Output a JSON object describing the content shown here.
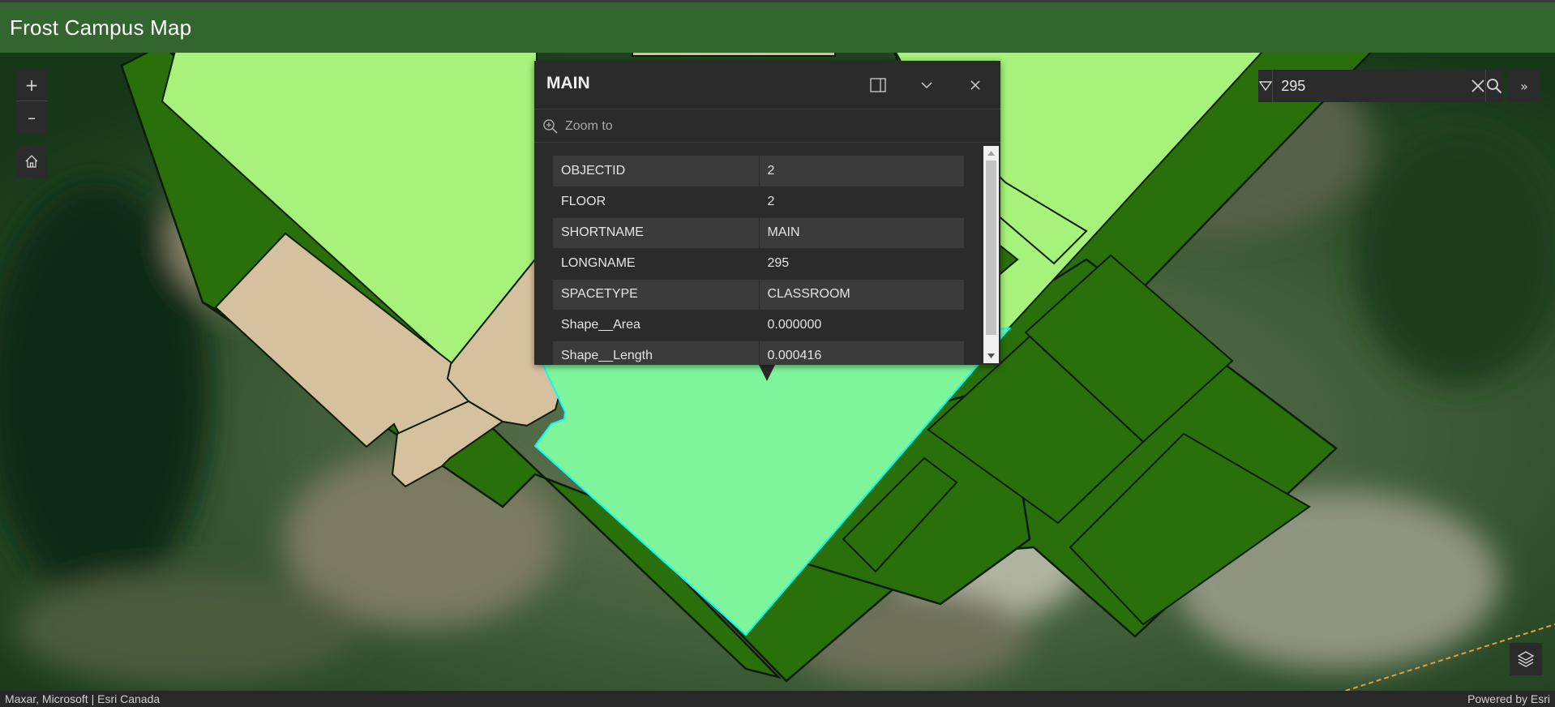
{
  "header": {
    "title": "Frost Campus Map"
  },
  "map": {
    "zoom_in_label": "+",
    "zoom_out_label": "–",
    "home_icon": "home-icon",
    "layers_icon": "layers-icon",
    "search": {
      "value": "295",
      "source_icon": "caret-down-icon",
      "clear_icon": "close-icon",
      "submit_icon": "search-icon",
      "expand_label": "»"
    },
    "highlight_color": "#00ffff",
    "feature_colors": {
      "selected": "#7ef59a",
      "open_space": "#a6f27a",
      "wall": "#2a700a",
      "room_beige": "#d6c19e"
    }
  },
  "popup": {
    "title": "MAIN",
    "dock_icon": "dock-icon",
    "collapse_icon": "chevron-down-icon",
    "close_icon": "close-icon",
    "zoom_to_label": "Zoom to",
    "fields": [
      {
        "name": "OBJECTID",
        "value": "2"
      },
      {
        "name": "FLOOR",
        "value": "2"
      },
      {
        "name": "SHORTNAME",
        "value": "MAIN"
      },
      {
        "name": "LONGNAME",
        "value": "295"
      },
      {
        "name": "SPACETYPE",
        "value": "CLASSROOM"
      },
      {
        "name": "Shape__Area",
        "value": "0.000000"
      },
      {
        "name": "Shape__Length",
        "value": "0.000416"
      }
    ]
  },
  "attribution": {
    "left": "Maxar, Microsoft | Esri Canada",
    "right": "Powered by Esri"
  }
}
